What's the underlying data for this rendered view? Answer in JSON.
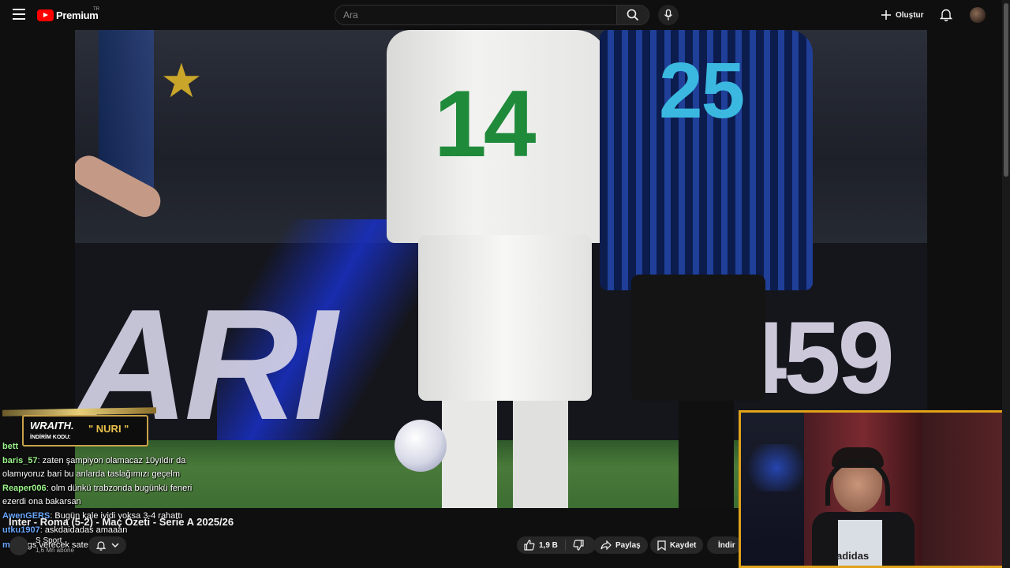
{
  "header": {
    "logo_text": "Premium",
    "logo_sup": "TR",
    "search_placeholder": "Ara",
    "create_label": "Oluştur"
  },
  "video": {
    "shirt_number_white": "14",
    "shirt_number_blue": "25",
    "board_text_left": "ARI",
    "board_text_right": "459"
  },
  "promo": {
    "brand": "WRAITH.",
    "code_label": "İNDİRİM KODU:",
    "code": "\" NURI \""
  },
  "chat": {
    "messages": [
      {
        "user": "bett",
        "text": "",
        "color": "#9cf58c"
      },
      {
        "user": "baris_57",
        "text": ": zaten şampiyon olamacaz 10yıldır da",
        "color": "#9cf58c"
      },
      {
        "user": "",
        "text": "olamıyoruz bari bu anlarda taslağımızı geçelm",
        "color": "#ffffff"
      },
      {
        "user": "Reaper006",
        "text": ": olm dünkü trabzonda bugünkü feneri",
        "color": "#9cf58c"
      },
      {
        "user": "",
        "text": "ezerdi ona bakarsan",
        "color": "#ffffff"
      },
      {
        "user": "AwenGERS",
        "text": ": Bugün kale iyidi yoksa 3-4 rahattı",
        "color": "#6aa8ff"
      },
      {
        "user": "utku1907",
        "text": ": askdaidadas amaaan",
        "color": "#6aa8ff"
      },
      {
        "user": "m2lu",
        "text": ": gs verecek sateri",
        "color": "#6aa8ff"
      }
    ]
  },
  "below": {
    "title": "Inter - Roma (5-2) - Maç Özeti - Serie A 2025/26",
    "channel_name": "S Sport",
    "channel_subs": "1,6 Mn abone",
    "like_count": "1,9 B",
    "share_label": "Paylaş",
    "save_label": "Kaydet",
    "download_label": "İndir"
  },
  "webcam": {
    "shirt_logo": "adidas"
  },
  "colors": {
    "accent_red": "#ff0000",
    "webcam_border": "#e0a21a"
  }
}
